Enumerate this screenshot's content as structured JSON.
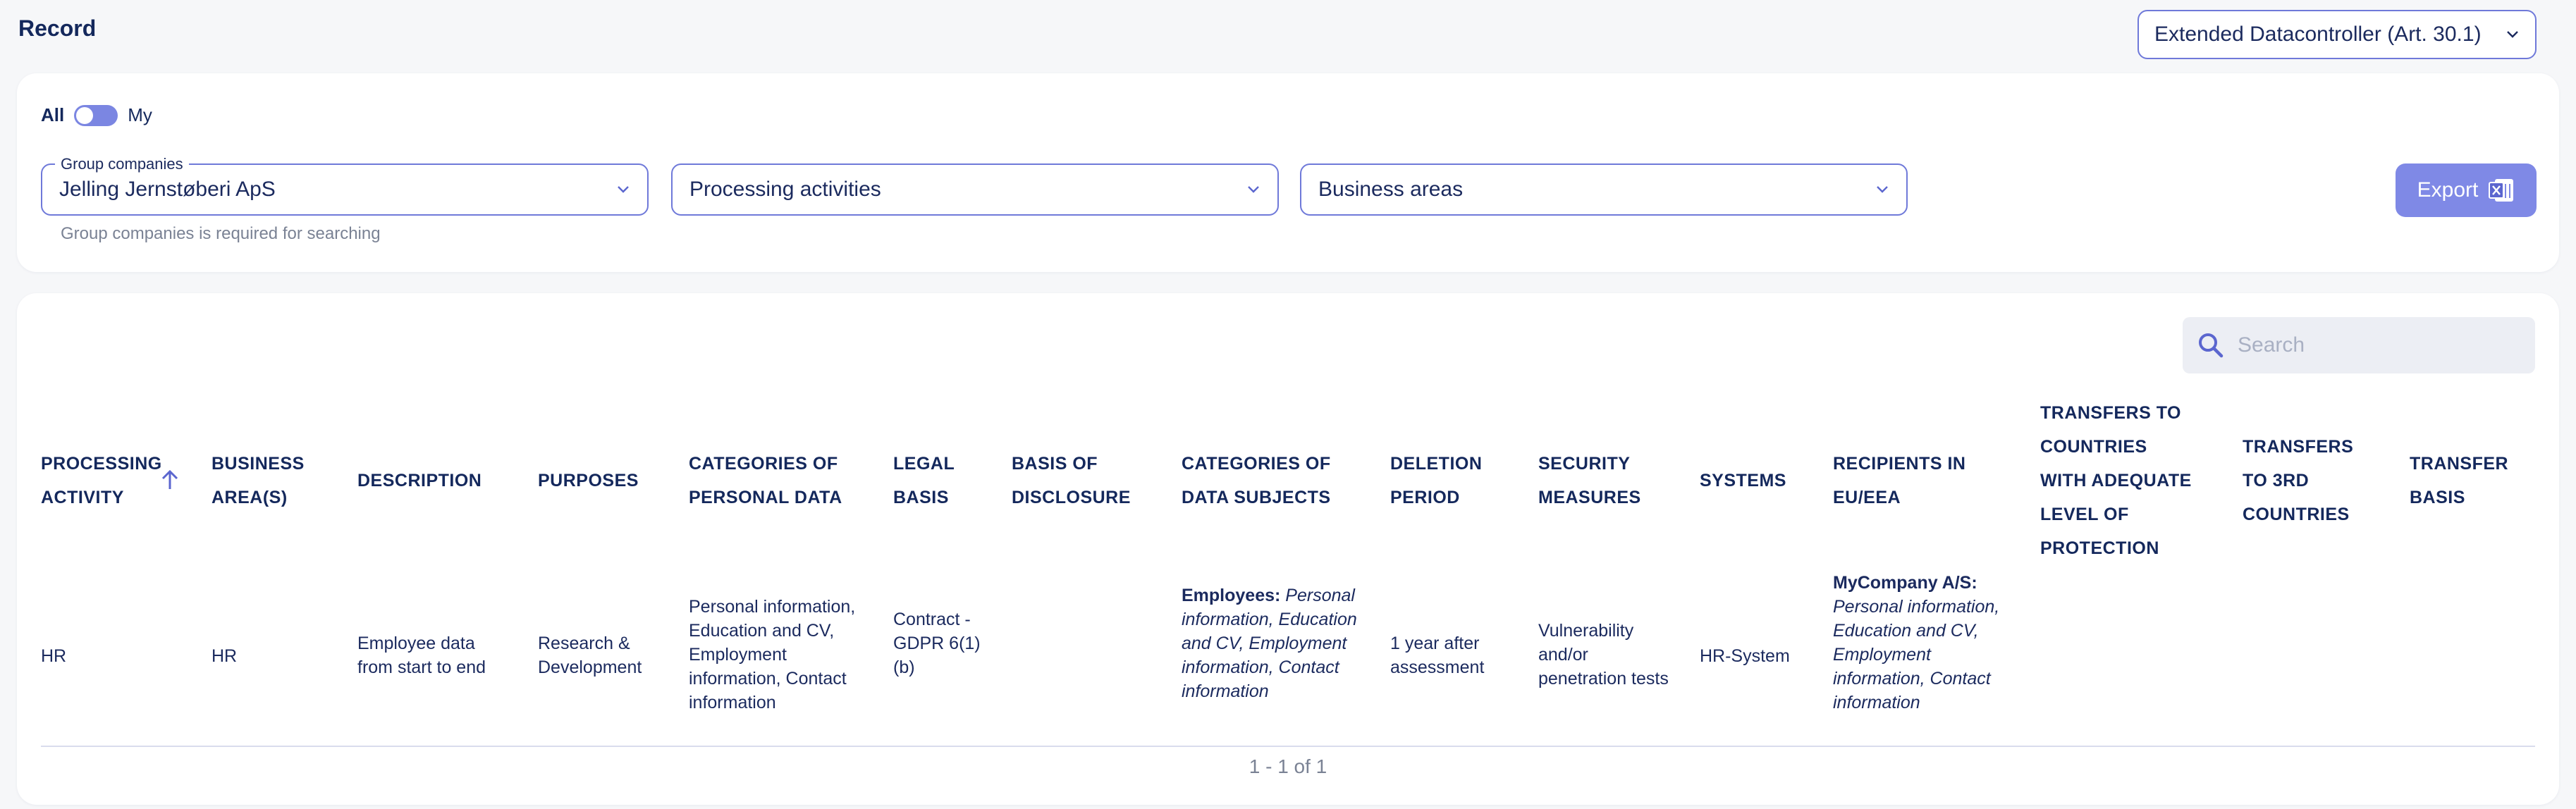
{
  "page": {
    "title": "Record",
    "controller_select": "Extended Datacontroller (Art. 30.1)"
  },
  "filters": {
    "toggle_all": "All",
    "toggle_my": "My",
    "group_companies_label": "Group companies",
    "group_companies_value": "Jelling Jernstøberi ApS",
    "processing_activities": "Processing activities",
    "business_areas": "Business areas",
    "helper": "Group companies is required for searching",
    "export_label": "Export"
  },
  "search": {
    "placeholder": "Search"
  },
  "table": {
    "headers": {
      "processing_activity_1": "PROCESSING",
      "processing_activity_2": "ACTIVITY",
      "business_area_1": "BUSINESS",
      "business_area_2": "AREA(S)",
      "description": "DESCRIPTION",
      "purposes": "PURPOSES",
      "categories_personal_1": "CATEGORIES OF",
      "categories_personal_2": "PERSONAL DATA",
      "legal_basis_1": "LEGAL",
      "legal_basis_2": "BASIS",
      "basis_disclosure_1": "BASIS OF",
      "basis_disclosure_2": "DISCLOSURE",
      "categories_subjects_1": "CATEGORIES OF",
      "categories_subjects_2": "DATA SUBJECTS",
      "deletion_1": "DELETION",
      "deletion_2": "PERIOD",
      "security_1": "SECURITY",
      "security_2": "MEASURES",
      "systems": "SYSTEMS",
      "recipients_1": "RECIPIENTS IN",
      "recipients_2": "EU/EEA",
      "transfers_adequate_1": "TRANSFERS TO",
      "transfers_adequate_2": "COUNTRIES",
      "transfers_adequate_3": "WITH ADEQUATE",
      "transfers_adequate_4": "LEVEL OF",
      "transfers_adequate_5": "PROTECTION",
      "transfers_3rd_1": "TRANSFERS",
      "transfers_3rd_2": "TO 3RD",
      "transfers_3rd_3": "COUNTRIES",
      "transfer_basis_1": "TRANSFER",
      "transfer_basis_2": "BASIS"
    },
    "row": {
      "processing_activity": "HR",
      "business_area": "HR",
      "description_1": "Employee data",
      "description_2": "from start to end",
      "purposes_1": "Research &",
      "purposes_2": "Development",
      "categories_personal_1": "Personal information,",
      "categories_personal_2": "Education and CV,",
      "categories_personal_3": "Employment",
      "categories_personal_4": "information, Contact",
      "categories_personal_5": "information",
      "legal_basis_1": "Contract -",
      "legal_basis_2": "GDPR 6(1)",
      "legal_basis_3": "(b)",
      "subjects_group": "Employees:",
      "subjects_1": "Personal",
      "subjects_2": "information, Education",
      "subjects_3": "and CV, Employment",
      "subjects_4": "information, Contact",
      "subjects_5": "information",
      "deletion_1": "1 year after",
      "deletion_2": "assessment",
      "security_1": "Vulnerability",
      "security_2": "and/or",
      "security_3": "penetration tests",
      "systems": "HR-System",
      "recipient_group": "MyCompany A/S:",
      "recipients_1": "Personal information,",
      "recipients_2": "Education and CV,",
      "recipients_3": "Employment",
      "recipients_4": "information, Contact",
      "recipients_5": "information"
    },
    "pagination": "1 - 1 of 1"
  }
}
